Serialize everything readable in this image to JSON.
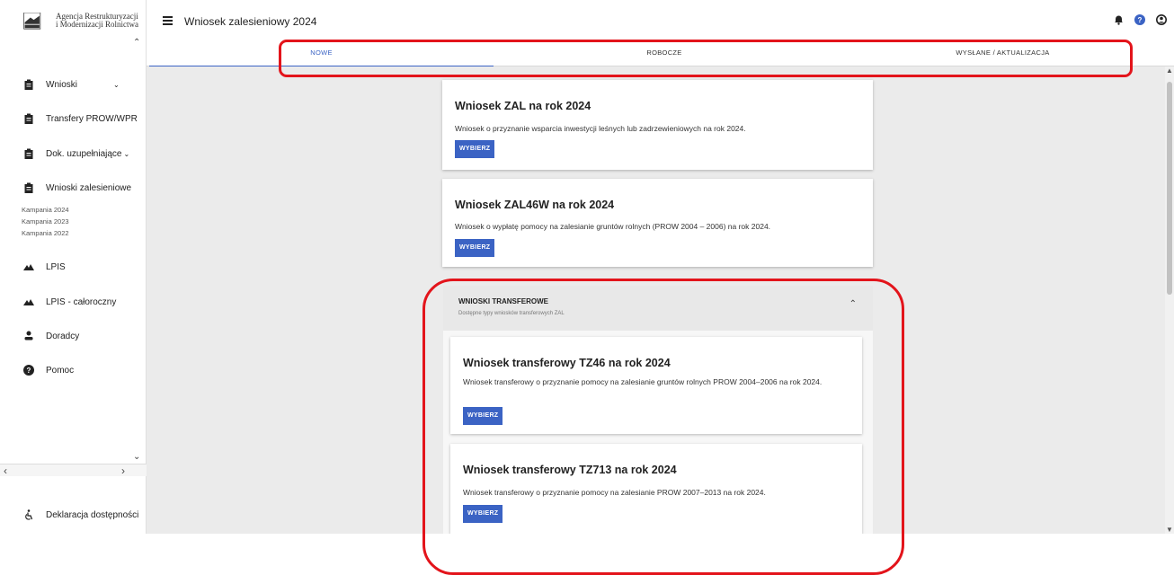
{
  "logo": {
    "line1": "Agencja Restrukturyzacji",
    "line2": "i Modernizacji Rolnictwa"
  },
  "sidebar": {
    "items": [
      {
        "label": "Wnioski",
        "icon": "clipboard-icon",
        "has_chevron": true
      },
      {
        "label": "Transfery PROW/WPR",
        "icon": "clipboard-icon"
      },
      {
        "label": "Dok. uzupełniające",
        "icon": "clipboard-icon",
        "has_chevron": true
      },
      {
        "label": "Wnioski zalesieniowe",
        "icon": "clipboard-icon"
      },
      {
        "label": "LPIS",
        "icon": "mountain-icon"
      },
      {
        "label": "LPIS - całoroczny",
        "icon": "mountain-icon"
      },
      {
        "label": "Doradcy",
        "icon": "person-icon"
      },
      {
        "label": "Pomoc",
        "icon": "help-icon"
      }
    ],
    "subitems": [
      "Kampania 2024",
      "Kampania 2023",
      "Kampania 2022"
    ],
    "footer": {
      "label": "Deklaracja dostępności",
      "icon": "accessibility-icon"
    }
  },
  "header": {
    "title": "Wniosek zalesieniowy 2024"
  },
  "tabs": [
    {
      "label": "NOWE",
      "active": true
    },
    {
      "label": "ROBOCZE",
      "active": false
    },
    {
      "label": "WYSŁANE / AKTUALIZACJA",
      "active": false
    }
  ],
  "cards": [
    {
      "title": "Wniosek ZAL na rok 2024",
      "desc": "Wniosek o przyznanie wsparcia inwestycji leśnych lub zadrzewieniowych na rok 2024.",
      "button": "WYBIERZ"
    },
    {
      "title": "Wniosek ZAL46W na rok 2024",
      "desc": "Wniosek o wypłatę pomocy na zalesianie gruntów rolnych (PROW 2004 – 2006) na rok 2024.",
      "button": "WYBIERZ"
    }
  ],
  "transfer_panel": {
    "title": "WNIOSKI TRANSFEROWE",
    "subtitle": "Dostępne typy wniosków transferowych ZAL",
    "cards": [
      {
        "title": "Wniosek transferowy TZ46 na rok 2024",
        "desc": "Wniosek transferowy o przyznanie pomocy na zalesianie gruntów rolnych PROW 2004–2006 na rok 2024.",
        "button": "WYBIERZ"
      },
      {
        "title": "Wniosek transferowy TZ713 na rok 2024",
        "desc": "Wniosek transferowy o przyznanie pomocy na zalesianie PROW 2007–2013 na rok 2024.",
        "button": "WYBIERZ"
      }
    ]
  },
  "colors": {
    "accent": "#3b63c4",
    "annotation": "#e3141b",
    "background": "#ebebeb"
  }
}
